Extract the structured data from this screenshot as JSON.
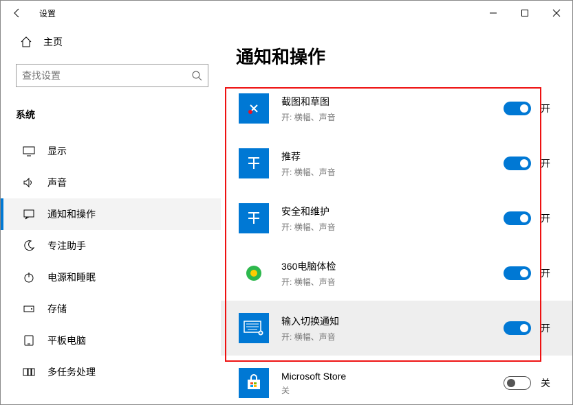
{
  "title": "设置",
  "home_label": "主页",
  "search_placeholder": "查找设置",
  "group_label": "系统",
  "nav": [
    {
      "label": "显示",
      "icon": "display"
    },
    {
      "label": "声音",
      "icon": "sound"
    },
    {
      "label": "通知和操作",
      "icon": "notify",
      "selected": true
    },
    {
      "label": "专注助手",
      "icon": "moon"
    },
    {
      "label": "电源和睡眠",
      "icon": "power"
    },
    {
      "label": "存储",
      "icon": "storage"
    },
    {
      "label": "平板电脑",
      "icon": "tablet"
    },
    {
      "label": "多任务处理",
      "icon": "multitask"
    }
  ],
  "page_title": "通知和操作",
  "apps": [
    {
      "name": "截图和草图",
      "sub": "开: 横幅、声音",
      "on": true,
      "state": "开",
      "icon": "snip"
    },
    {
      "name": "推荐",
      "sub": "开: 横幅、声音",
      "on": true,
      "state": "开",
      "icon": "tile"
    },
    {
      "name": "安全和维护",
      "sub": "开: 横幅、声音",
      "on": true,
      "state": "开",
      "icon": "tile"
    },
    {
      "name": "360电脑体检",
      "sub": "开: 横幅、声音",
      "on": true,
      "state": "开",
      "icon": "360"
    },
    {
      "name": "输入切换通知",
      "sub": "开: 横幅、声音",
      "on": true,
      "state": "开",
      "icon": "keyboard",
      "hover": true
    },
    {
      "name": "Microsoft Store",
      "sub": "关",
      "on": false,
      "state": "关",
      "icon": "store"
    }
  ]
}
